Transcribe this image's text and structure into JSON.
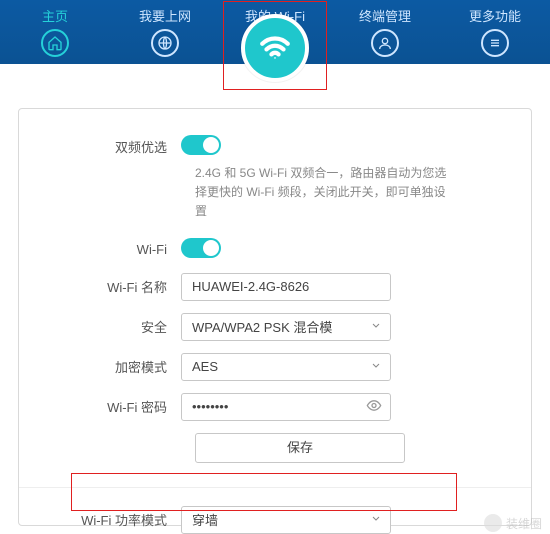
{
  "nav": {
    "items": [
      {
        "label": "主页",
        "icon": "home-icon"
      },
      {
        "label": "我要上网",
        "icon": "globe-icon"
      },
      {
        "label": "我的 Wi-Fi",
        "icon": "wifi-icon"
      },
      {
        "label": "终端管理",
        "icon": "user-icon"
      },
      {
        "label": "更多功能",
        "icon": "menu-icon"
      }
    ]
  },
  "form": {
    "dualband_label": "双频优选",
    "dualband_on": true,
    "dualband_desc": "2.4G 和 5G Wi-Fi 双频合一，路由器自动为您选择更快的 Wi-Fi 频段，关闭此开关，即可单独设置",
    "wifi_label": "Wi-Fi",
    "wifi_on": true,
    "name_label": "Wi-Fi 名称",
    "name_value": "HUAWEI-2.4G-8626",
    "security_label": "安全",
    "security_value": "WPA/WPA2 PSK 混合模",
    "encrypt_label": "加密模式",
    "encrypt_value": "AES",
    "password_label": "Wi-Fi 密码",
    "password_value": "••••••••",
    "save_label": "保存",
    "power_label": "Wi-Fi 功率模式",
    "power_value": "穿墙"
  },
  "watermark": "装维圈"
}
